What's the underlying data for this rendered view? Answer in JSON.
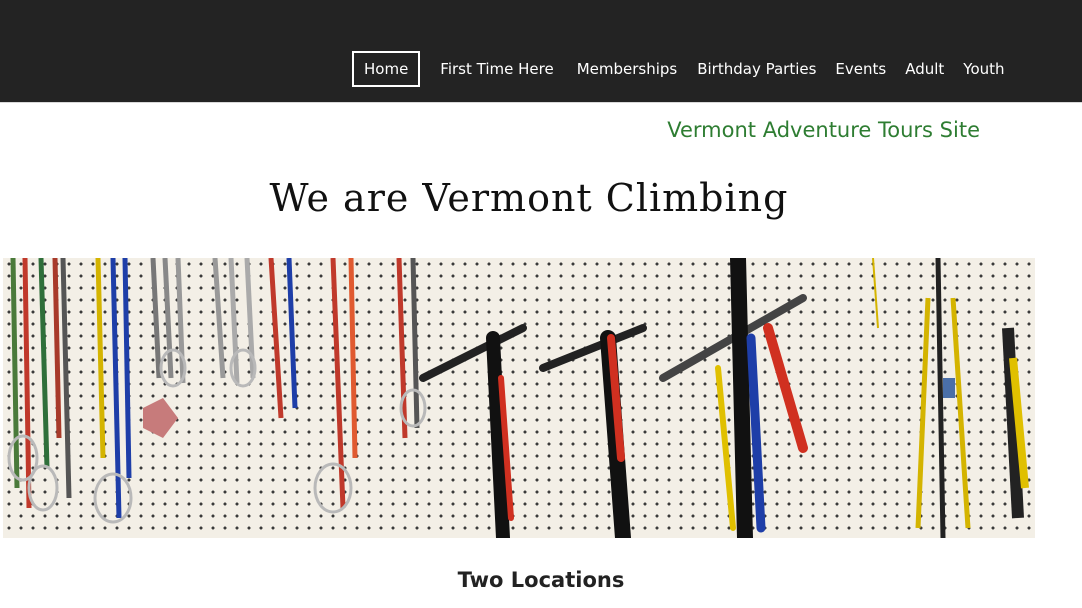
{
  "nav": {
    "items": [
      {
        "label": "Home",
        "active": true
      },
      {
        "label": "First Time Here",
        "active": false
      },
      {
        "label": "Memberships",
        "active": false
      },
      {
        "label": "Birthday Parties",
        "active": false
      },
      {
        "label": "Events",
        "active": false
      },
      {
        "label": "Adult",
        "active": false
      },
      {
        "label": "Youth",
        "active": false
      }
    ]
  },
  "header": {
    "adventure_link": "Vermont Adventure Tours Site",
    "adventure_link_color": "#2e7d32"
  },
  "hero": {
    "title": "We are Vermont Climbing",
    "banner_icon": "climbing-gear-photo"
  },
  "section": {
    "title": "Two Locations"
  },
  "colors": {
    "topbar": "#232323",
    "accent_green": "#2e7d32"
  }
}
